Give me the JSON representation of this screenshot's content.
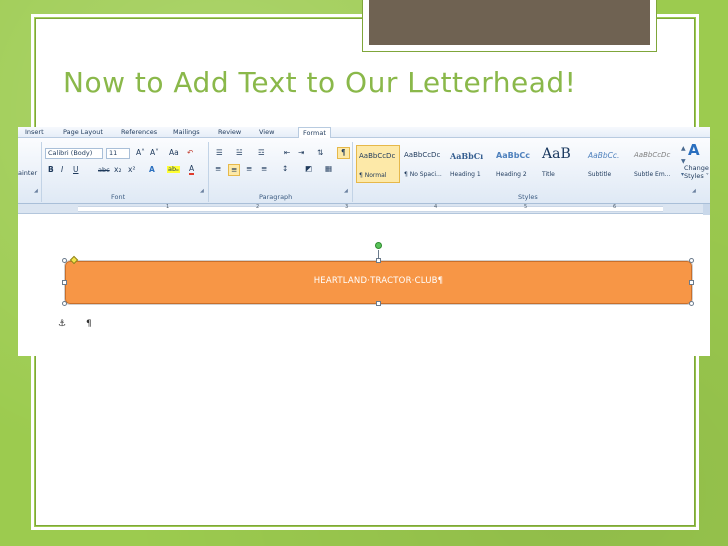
{
  "slide": {
    "title": "Now to Add Text to Our Letterhead!",
    "colors": {
      "background": "#9ccb4f",
      "title": "#8ab84a",
      "tab": "#6f6252"
    }
  },
  "word": {
    "tabs": [
      "Insert",
      "Page Layout",
      "References",
      "Mailings",
      "Review",
      "View",
      "Format"
    ],
    "clipboard": {
      "partial_label": "ainter"
    },
    "font": {
      "name": "Calibri (Body)",
      "size": "11",
      "group_label": "Font",
      "grow_glyph": "A˄",
      "shrink_glyph": "A˅",
      "case_glyph": "Aa",
      "clear_glyph": "↶",
      "bold": "B",
      "italic": "I",
      "underline": "U",
      "strike": "abc",
      "subscript": "x₂",
      "superscript": "x²",
      "effects_glyph": "A",
      "highlight_glyph": "abₒ",
      "color_glyph": "A"
    },
    "paragraph": {
      "group_label": "Paragraph",
      "bullets": "☰",
      "numbering": "☱",
      "multilevel": "☲",
      "decrease_indent": "⇤",
      "increase_indent": "⇥",
      "sort": "⇅",
      "show_marks": "¶",
      "align_left": "≡",
      "align_center": "≡",
      "align_right": "≡",
      "justify": "≡",
      "line_spacing": "↕",
      "shading": "◩",
      "borders": "▦"
    },
    "styles": {
      "group_label": "Styles",
      "items": [
        {
          "sample": "AaBbCcDc",
          "name": "¶ Normal"
        },
        {
          "sample": "AaBbCcDc",
          "name": "¶ No Spaci..."
        },
        {
          "sample": "AaBbCı",
          "name": "Heading 1"
        },
        {
          "sample": "AaBbCc",
          "name": "Heading 2"
        },
        {
          "sample": "AaB",
          "name": "Title"
        },
        {
          "sample": "AaBbCc.",
          "name": "Subtitle"
        },
        {
          "sample": "AaBbCcDc",
          "name": "Subtle Em..."
        }
      ],
      "change_styles_label_1": "Change",
      "change_styles_label_2": "Styles ˅"
    },
    "ruler": {
      "numbers": [
        "1",
        "2",
        "3",
        "4",
        "5",
        "6"
      ]
    },
    "document": {
      "banner_text": "HEARTLAND·TRACTOR·CLUB¶",
      "anchor_glyph": "⚓",
      "pilcrow": "¶",
      "banner_color": "#f79646"
    }
  }
}
